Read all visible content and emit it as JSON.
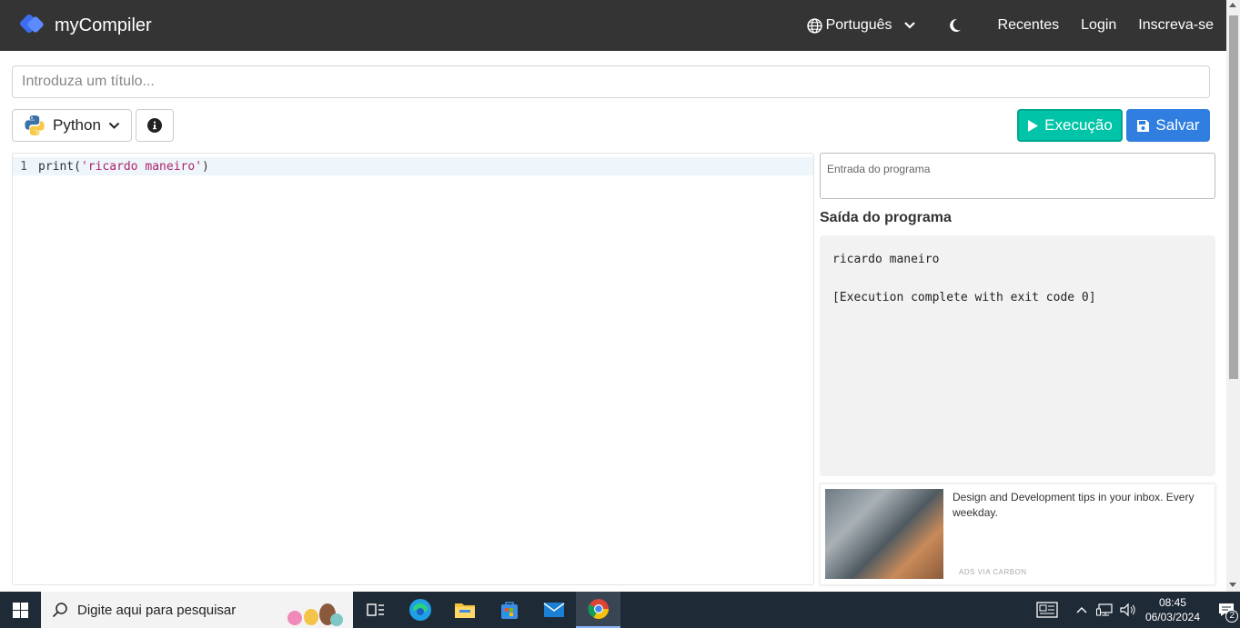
{
  "navbar": {
    "brand": "myCompiler",
    "language": "Português",
    "links": [
      "Recentes",
      "Login",
      "Inscreva-se"
    ]
  },
  "title_input": {
    "placeholder": "Introduza um título..."
  },
  "toolbar": {
    "language": "Python",
    "run_label": "Execução",
    "save_label": "Salvar"
  },
  "editor": {
    "line_number": "1",
    "code_fn": "print(",
    "code_str": "'ricardo maneiro'",
    "code_end": ")"
  },
  "stdin": {
    "placeholder": "Entrada do programa"
  },
  "output": {
    "label": "Saída do programa",
    "line1": "ricardo maneiro",
    "line2": "[Execution complete with exit code 0]"
  },
  "ad": {
    "text": "Design and Development tips in your inbox. Every weekday.",
    "via": "ADS VIA CARBON"
  },
  "taskbar": {
    "search_placeholder": "Digite aqui para pesquisar",
    "time": "08:45",
    "date": "06/03/2024",
    "notifications": "2"
  },
  "colors": {
    "navbar": "#343434",
    "run": "#00c4a7",
    "save": "#2f7ee0",
    "string": "#b0246a"
  }
}
